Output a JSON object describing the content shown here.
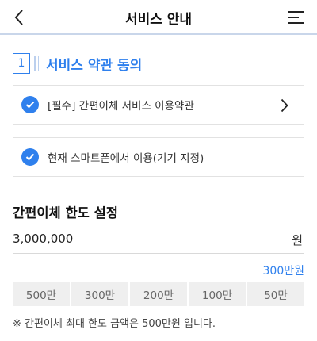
{
  "header": {
    "title": "서비스 안내",
    "back_icon": "chevron-left-icon",
    "menu_icon": "hamburger-menu-icon"
  },
  "section": {
    "step_number": "1",
    "title": "서비스 약관 동의"
  },
  "agreements": [
    {
      "label": "[필수] 간편이체 서비스 이용약관",
      "checked": true,
      "has_arrow": true
    },
    {
      "label": "현재 스마트폰에서 이용(기기 지정)",
      "checked": true,
      "has_arrow": false
    }
  ],
  "limit": {
    "title": "간편이체 한도 설정",
    "amount": "3,000,000",
    "unit": "원",
    "amount_in_words": "300만원",
    "buttons": [
      "500만",
      "300만",
      "200만",
      "100만",
      "50만"
    ],
    "note": "※ 간편이체 최대 한도 금액은 500만원 입니다."
  },
  "colors": {
    "accent": "#2f80ed",
    "divider": "#c9d6ea",
    "button_bg": "#efefef"
  }
}
